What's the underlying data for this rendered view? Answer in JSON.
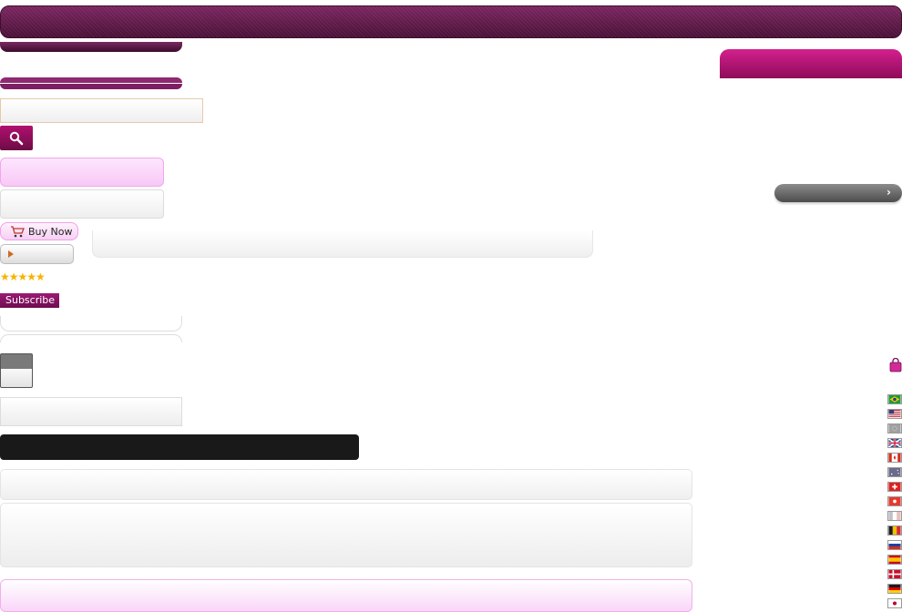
{
  "buy_button": {
    "label": "Buy Now",
    "icon": "cart-icon"
  },
  "subscribe_button": {
    "label": "Subscribe"
  },
  "rating": {
    "stars": 5,
    "max": 5,
    "glyph": "★★★★★"
  },
  "search": {
    "icon": "search-icon",
    "placeholder": ""
  },
  "colors": {
    "brand": "#5e1846",
    "accent": "#b0106f",
    "pink": "#f8c8f6",
    "dark": "#191919"
  },
  "flags": [
    {
      "name": "flag-brazil"
    },
    {
      "name": "flag-usa"
    },
    {
      "name": "flag-eu"
    },
    {
      "name": "flag-uk"
    },
    {
      "name": "flag-canada"
    },
    {
      "name": "flag-australia"
    },
    {
      "name": "flag-switzerland"
    },
    {
      "name": "flag-hong-kong"
    },
    {
      "name": "flag-france"
    },
    {
      "name": "flag-belgium"
    },
    {
      "name": "flag-russia"
    },
    {
      "name": "flag-spain"
    },
    {
      "name": "flag-denmark"
    },
    {
      "name": "flag-germany"
    },
    {
      "name": "flag-japan"
    }
  ]
}
